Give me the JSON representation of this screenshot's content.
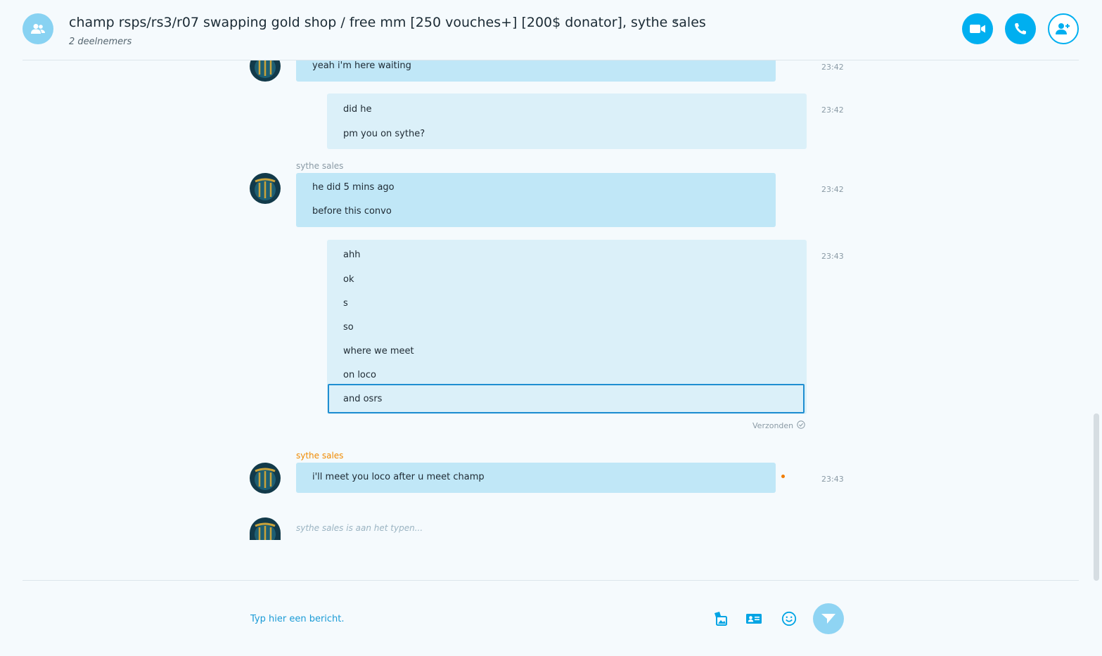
{
  "header": {
    "title": "champ rsps/rs3/r07 swapping gold shop / free mm [250 vouches+] [200$ donator], sythe sales",
    "participants": "2 deelnemers",
    "icons": {
      "group_avatar": "group-icon",
      "video": "video-call-icon",
      "audio": "call-icon",
      "add": "add-person-icon"
    },
    "accent": "#00aff0"
  },
  "messages": [
    {
      "id": "m1",
      "direction": "incoming",
      "lines": [
        "yeah i'm here waiting"
      ],
      "time": "23:42"
    },
    {
      "id": "m2",
      "direction": "outgoing",
      "lines": [
        "did he",
        "pm you on sythe?"
      ],
      "time": "23:42"
    },
    {
      "id": "m3",
      "direction": "incoming",
      "sender": "sythe sales",
      "lines": [
        "he did 5 mins ago",
        "before this convo"
      ],
      "time": "23:42"
    },
    {
      "id": "m4",
      "direction": "outgoing",
      "lines": [
        "ahh",
        "ok",
        "s",
        "so",
        "where we meet",
        "on loco",
        "and osrs"
      ],
      "time": "23:43",
      "status": "Verzonden"
    },
    {
      "id": "m5",
      "direction": "incoming",
      "sender": "sythe sales",
      "lines": [
        "i'll meet you loco after u meet champ"
      ],
      "time": "23:43"
    }
  ],
  "typing_indicator": "sythe sales is aan het typen...",
  "composer": {
    "placeholder": "Typ hier een bericht.",
    "icons": [
      "media-icon",
      "contact-card-icon",
      "emoji-icon",
      "send-icon"
    ]
  },
  "colors": {
    "incoming_bubble": "#c0e7f7",
    "outgoing_bubble": "#dbf0f9",
    "sender_highlight": "#f08a00"
  }
}
